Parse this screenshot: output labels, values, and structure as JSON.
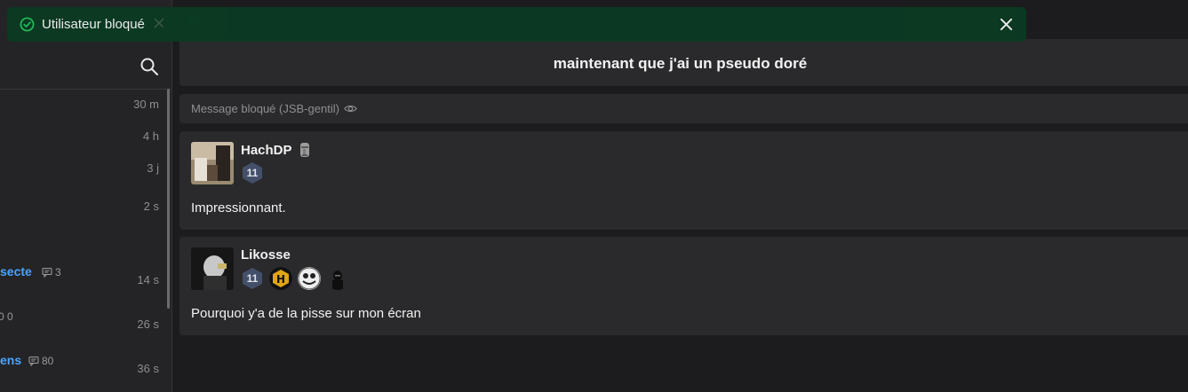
{
  "toast": {
    "message": "Utilisateur bloqué",
    "icon": "check-circle-icon",
    "color": "#0b3a22"
  },
  "sidebar": {
    "items": [
      {
        "time": "30 m"
      },
      {
        "time": "4 h"
      },
      {
        "time": "3 j"
      },
      {
        "time": "2 s"
      },
      {
        "title_fragment": "secte",
        "comments": "3",
        "time": "14 s"
      },
      {
        "title_fragment": "",
        "comments": "0 0",
        "time": "26 s"
      },
      {
        "title_fragment": "ens",
        "comments": "80",
        "time": "36 s"
      }
    ]
  },
  "topic": {
    "title": "maintenant que j'ai un pseudo doré"
  },
  "blocked_message": {
    "text": "Message bloqué (JSB-gentil)"
  },
  "posts": [
    {
      "author": "HachDP",
      "level": "11",
      "body": "Impressionnant."
    },
    {
      "author": "Likosse",
      "level": "11",
      "body": "Pourquoi y'a de la pisse sur mon écran"
    }
  ],
  "colors": {
    "accent_link": "#4da3ff",
    "toast_success": "#22c55e"
  }
}
